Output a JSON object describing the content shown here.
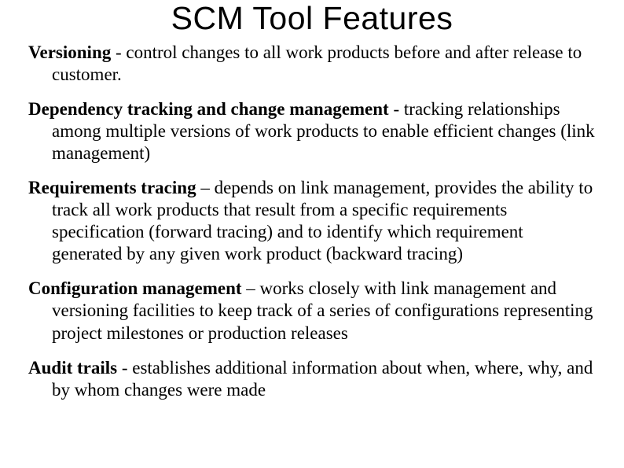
{
  "title": "SCM Tool Features",
  "features": [
    {
      "term": "Versioning",
      "desc": " - control changes to all work products before and after release to customer."
    },
    {
      "term": "Dependency tracking and change management",
      "desc": " - tracking relationships among multiple versions of work products to enable efficient changes (link management)"
    },
    {
      "term": "Requirements tracing",
      "desc": " – depends on link management, provides the ability to track all work products that result from a specific requirements specification (forward tracing) and to identify which requirement generated by any given work product (backward tracing)"
    },
    {
      "term": "Configuration management",
      "desc": " – works closely with link management and versioning facilities to keep track of a series of configurations representing project milestones or production releases"
    },
    {
      "term": "Audit trails",
      "desc": " -  establishes additional information about when, where, why, and by whom changes were made"
    }
  ]
}
